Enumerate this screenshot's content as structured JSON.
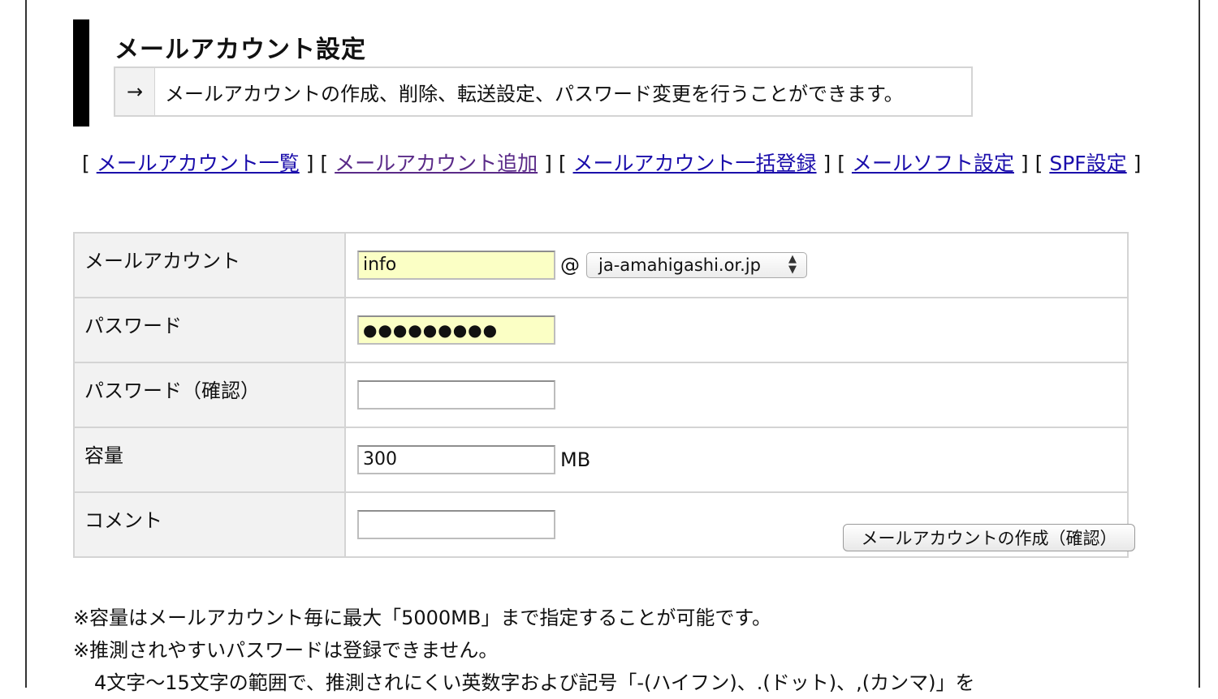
{
  "header": {
    "title": "メールアカウント設定",
    "arrow": "→",
    "description": "メールアカウントの作成、削除、転送設定、パスワード変更を行うことができます。"
  },
  "nav": {
    "open": "[",
    "close": "]",
    "links": [
      {
        "label": "メールアカウント一覧"
      },
      {
        "label": "メールアカウント追加"
      },
      {
        "label": "メールアカウント一括登録"
      },
      {
        "label": "メールソフト設定"
      },
      {
        "label": "SPF設定"
      }
    ]
  },
  "form": {
    "account": {
      "label": "メールアカウント",
      "value": "info",
      "at": "@",
      "domain": "ja-amahigashi.or.jp"
    },
    "password": {
      "label": "パスワード",
      "value": "●●●●●●●●●"
    },
    "password_confirm": {
      "label": "パスワード（確認）",
      "value": ""
    },
    "capacity": {
      "label": "容量",
      "value": "300",
      "unit": "MB"
    },
    "comment": {
      "label": "コメント",
      "value": ""
    }
  },
  "submit_label": "メールアカウントの作成（確認）",
  "notes": [
    "※容量はメールアカウント毎に最大「5000MB」まで指定することが可能です。",
    "※推測されやすいパスワードは登録できません。",
    "4文字～15文字の範囲で、推測されにくい英数字および記号「-(ハイフン)、.(ドット)、,(カンマ)」を"
  ]
}
